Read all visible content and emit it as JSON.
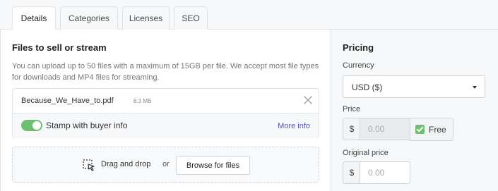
{
  "tabs": [
    {
      "label": "Details",
      "active": true
    },
    {
      "label": "Categories",
      "active": false
    },
    {
      "label": "Licenses",
      "active": false
    },
    {
      "label": "SEO",
      "active": false
    }
  ],
  "files": {
    "heading": "Files to sell or stream",
    "description": "You can upload up to 50 files with a maximum of 15GB per file. We accept most file types for downloads and MP4 files for streaming.",
    "file": {
      "name": "Because_We_Have_to.pdf",
      "size": "8.3 MB"
    },
    "stamp": {
      "label": "Stamp with buyer info",
      "enabled": true,
      "more_info": "More info"
    },
    "dropzone": {
      "drag_text": "Drag and drop",
      "or_text": "or",
      "browse_label": "Browse for files"
    }
  },
  "pricing": {
    "heading": "Pricing",
    "currency_label": "Currency",
    "currency_value": "USD ($)",
    "price_label": "Price",
    "currency_symbol": "$",
    "price_placeholder": "0.00",
    "free_label": "Free",
    "free_checked": true,
    "original_price_label": "Original price",
    "original_price_placeholder": "0.00"
  },
  "colors": {
    "accent_green": "#6fbf73",
    "link_purple": "#5b53b8"
  }
}
